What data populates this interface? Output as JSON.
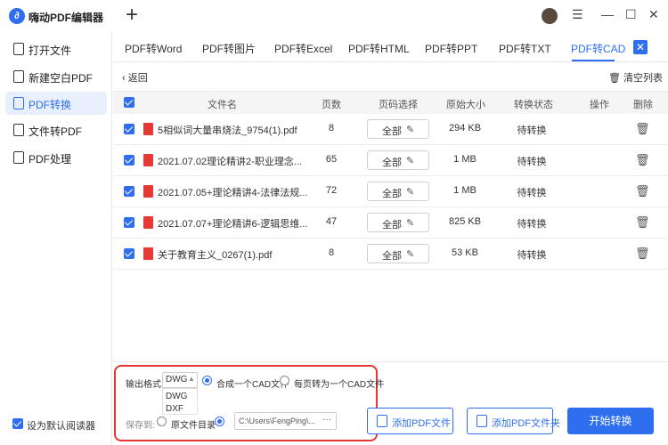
{
  "app": {
    "title": "嗨动PDF编辑器",
    "logo_glyph": "∂",
    "add_tab_glyph": "+",
    "window_controls": {
      "menu": "☰",
      "minimize": "—",
      "maximize": "☐",
      "close": "✕"
    }
  },
  "sidebar": {
    "items": [
      {
        "label": "打开文件",
        "icon": "open-file-icon"
      },
      {
        "label": "新建空白PDF",
        "icon": "new-pdf-icon"
      },
      {
        "label": "PDF转换",
        "icon": "pdf-convert-icon"
      },
      {
        "label": "文件转PDF",
        "icon": "file-to-pdf-icon"
      },
      {
        "label": "PDF处理",
        "icon": "pdf-process-icon"
      }
    ],
    "default_reader_label": "设为默认阅读器"
  },
  "tabs": [
    {
      "label": "PDF转Word"
    },
    {
      "label": "PDF转图片"
    },
    {
      "label": "PDF转Excel"
    },
    {
      "label": "PDF转HTML"
    },
    {
      "label": "PDF转PPT"
    },
    {
      "label": "PDF转TXT"
    },
    {
      "label": "PDF转CAD"
    }
  ],
  "tab_close_glyph": "✕",
  "toolbar": {
    "back_label": "‹  返回",
    "clear_label": "清空列表"
  },
  "table": {
    "headers": {
      "filename": "文件名",
      "pages": "页数",
      "page_select": "页码选择",
      "size": "原始大小",
      "status": "转换状态",
      "action": "操作",
      "delete": "删除"
    },
    "rows": [
      {
        "name": "5相似词大量串烧法_9754(1).pdf",
        "pages": "8",
        "page_select": "全部",
        "size": "294 KB",
        "status": "待转换"
      },
      {
        "name": "2021.07.02理论精讲2-职业理念...",
        "pages": "65",
        "page_select": "全部",
        "size": "1 MB",
        "status": "待转换"
      },
      {
        "name": "2021.07.05+理论精讲4-法律法规...",
        "pages": "72",
        "page_select": "全部",
        "size": "1 MB",
        "status": "待转换"
      },
      {
        "name": "2021.07.07+理论精讲6-逻辑思维...",
        "pages": "47",
        "page_select": "全部",
        "size": "825 KB",
        "status": "待转换"
      },
      {
        "name": "关于教育主义_0267(1).pdf",
        "pages": "8",
        "page_select": "全部",
        "size": "53 KB",
        "status": "待转换"
      }
    ]
  },
  "output": {
    "format_label": "输出格式:",
    "format_value": "DWG",
    "format_options": [
      "DWG",
      "DXF"
    ],
    "mode_options": [
      "合成一个CAD文件",
      "每页转为一个CAD文件"
    ],
    "save_label": "保存到:",
    "save_options": [
      "原文件目录"
    ],
    "save_path": "C:\\Users\\FengPing\\..."
  },
  "actions": {
    "add_file": "添加PDF文件",
    "add_folder": "添加PDF文件夹",
    "start": "开始转换"
  },
  "colors": {
    "accent": "#2f6fef",
    "highlight": "#e53935"
  }
}
